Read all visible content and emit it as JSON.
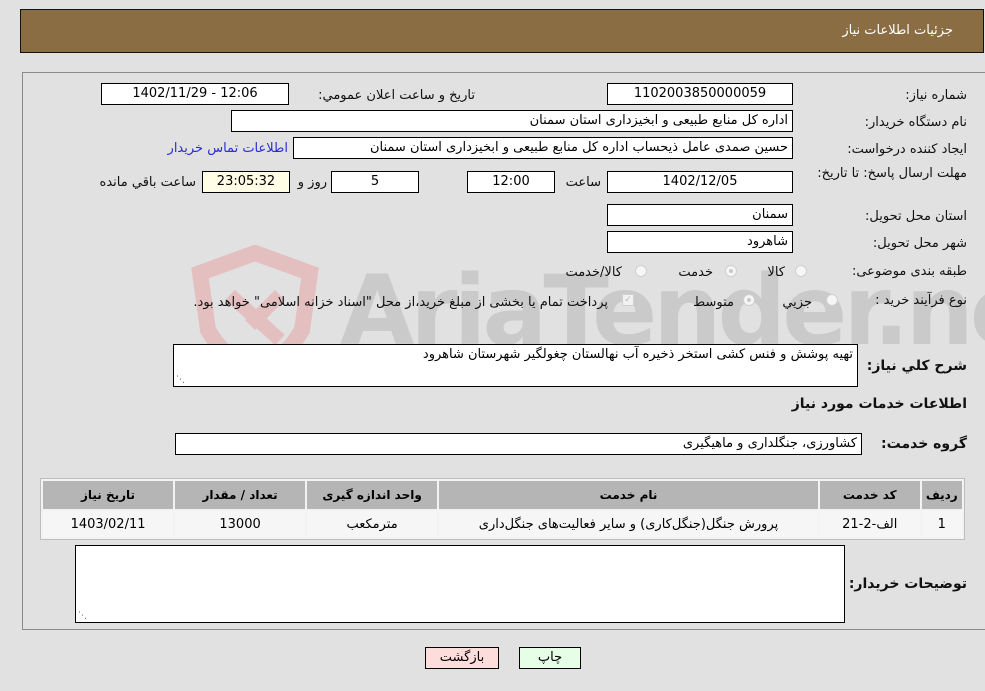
{
  "header": {
    "title": "جزئیات اطلاعات نیاز"
  },
  "fields": {
    "need_number": {
      "label": "شماره نیاز:",
      "value": "1102003850000059"
    },
    "announce_datetime": {
      "label": "تاریخ و ساعت اعلان عمومي:",
      "value": "1402/11/29 - 12:06"
    },
    "buyer_org": {
      "label": "نام دستگاه خریدار:",
      "value": "اداره کل منابع طبیعی و ابخیزداری استان سمنان"
    },
    "requester": {
      "label": "ایجاد کننده درخواست:",
      "value": "حسین صمدی عامل ذیحساب اداره کل منابع طبیعی و ابخیزداری استان سمنان",
      "contact_link": "اطلاعات تماس خریدار"
    },
    "deadline": {
      "label": "مهلت ارسال پاسخ: تا تاریخ:",
      "date": "1402/12/05",
      "time_label": "ساعت",
      "time": "12:00",
      "days": "5",
      "days_label": "روز و",
      "remaining": "23:05:32",
      "remaining_label": "ساعت باقي مانده"
    },
    "province": {
      "label": "استان محل تحویل:",
      "value": "سمنان"
    },
    "city": {
      "label": "شهر محل تحویل:",
      "value": "شاهرود"
    },
    "category": {
      "label": "طبقه بندی موضوعی:",
      "options": [
        "کالا",
        "خدمت",
        "کالا/خدمت"
      ],
      "selected": "خدمت"
    },
    "process_type": {
      "label": "نوع فرآیند خرید :",
      "options": [
        "جزيي",
        "متوسط"
      ],
      "selected": "متوسط",
      "checkbox_label": "پرداخت تمام یا بخشی از مبلغ خرید،از محل \"اسناد خزانه اسلامی\" خواهد بود.",
      "checkbox_checked": true
    },
    "description": {
      "label": "شرح کلي نیاز:",
      "value": "تهیه پوشش و فنس کشی استخر ذخیره آب نهالستان چغولگیر شهرستان شاهرود"
    },
    "services_section_title": "اطلاعات خدمات مورد نیاز",
    "service_group": {
      "label": "گروه خدمت:",
      "value": "کشاورزی، جنگلداری و ماهیگیری"
    },
    "buyer_notes": {
      "label": "توضیحات خریدار:",
      "value": ""
    }
  },
  "services_table": {
    "columns": [
      "ردیف",
      "کد خدمت",
      "نام خدمت",
      "واحد اندازه گیری",
      "تعداد / مقدار",
      "تاریخ نیاز"
    ],
    "rows": [
      [
        "1",
        "الف-2-21",
        "پرورش جنگل(جنگل‌کاری) و سایر فعالیت‌های جنگل‌داری",
        "مترمکعب",
        "13000",
        "1403/02/11"
      ]
    ]
  },
  "buttons": {
    "print": "چاپ",
    "back": "بازگشت"
  },
  "watermark": "AriaTender.neT"
}
